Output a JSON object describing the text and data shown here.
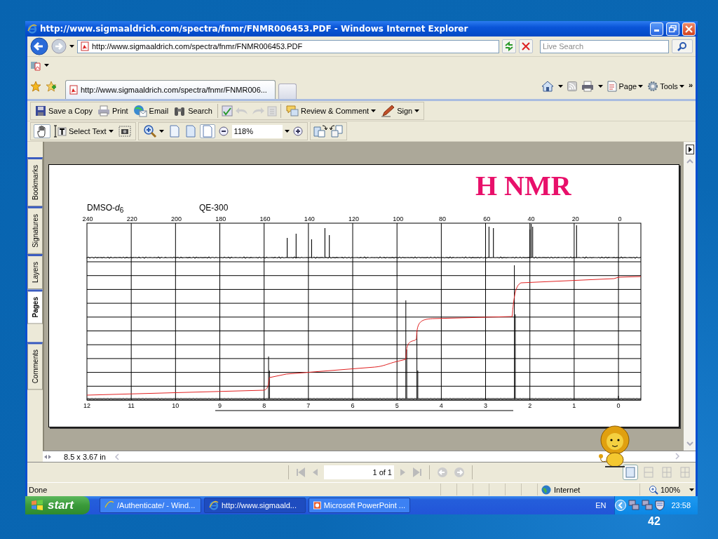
{
  "window": {
    "title": "http://www.sigmaaldrich.com/spectra/fnmr/FNMR006453.PDF - Windows Internet Explorer"
  },
  "address_bar": {
    "value": "http://www.sigmaaldrich.com/spectra/fnmr/FNMR006453.PDF"
  },
  "search": {
    "placeholder": "Live Search"
  },
  "tabs": [
    {
      "label": "http://www.sigmaaldrich.com/spectra/fnmr/FNMR006...",
      "selected": true
    }
  ],
  "command_bar": {
    "items": [
      "Page",
      "Tools"
    ],
    "overflow": "»"
  },
  "acrobat_toolbar": {
    "items": [
      "Save a Copy",
      "Print",
      "Email",
      "Search",
      "Review & Comment",
      "Sign"
    ],
    "select_tool": "Select Text",
    "zoom": "118%"
  },
  "side_tabs": [
    {
      "label": "Bookmarks",
      "selected": false
    },
    {
      "label": "Signatures",
      "selected": false
    },
    {
      "label": "Layers",
      "selected": false
    },
    {
      "label": "Pages",
      "selected": true
    },
    {
      "label": "Comments",
      "selected": false
    }
  ],
  "document": {
    "title": "H NMR",
    "solvent": "DMSO-*d*$_{6}$",
    "instrument": "QE-300",
    "top_axis_labels": [
      "240",
      "220",
      "200",
      "180",
      "160",
      "140",
      "120",
      "100",
      "80",
      "60",
      "40",
      "20",
      "0"
    ],
    "bottom_axis_labels": [
      "12",
      "11",
      "10",
      "9",
      "8",
      "7",
      "6",
      "5",
      "4",
      "3",
      "2",
      "1",
      "0"
    ]
  },
  "page_size": "8.5 x 3.67 in",
  "page_nav": {
    "value": "1 of 1"
  },
  "view_modes": [
    {
      "selected": true
    },
    {
      "selected": false
    },
    {
      "selected": false
    },
    {
      "selected": false
    }
  ],
  "status_bar": {
    "text": "Done",
    "zone": "Internet",
    "zoom": "100%"
  },
  "taskbar": {
    "start": "start",
    "tasks": [
      {
        "label": "/Authenticate/ - Wind...",
        "selected": false,
        "kind": "ie"
      },
      {
        "label": "http://www.sigmaald...",
        "selected": true,
        "kind": "ie"
      },
      {
        "label": "Microsoft PowerPoint ...",
        "selected": false,
        "kind": "ppt"
      }
    ],
    "language": "EN",
    "clock": "23:58"
  },
  "slide_number": "42"
}
